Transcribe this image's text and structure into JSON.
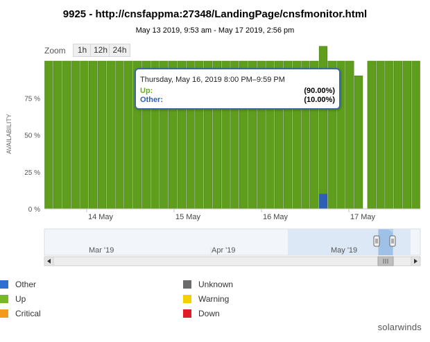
{
  "title": "9925 - http://cnsfappma:27348/LandingPage/cnsfmonitor.html",
  "subtitle": "May 13 2019, 9:53 am - May 17 2019, 2:56 pm",
  "zoom": {
    "label": "Zoom",
    "buttons": [
      "1h",
      "12h",
      "24h"
    ]
  },
  "chart_data": {
    "type": "bar",
    "stacked": true,
    "ylabel": "AVAILABILITY",
    "y_ticks": [
      "0 %",
      "25 %",
      "50 %",
      "75 %"
    ],
    "ylim": [
      0,
      100
    ],
    "x_ticks": [
      "14 May",
      "15 May",
      "16 May",
      "17 May"
    ],
    "bar_count": 42,
    "gap_after_bar": 35,
    "series": [
      {
        "name": "Up",
        "color": "#5e9e1c",
        "values": [
          100,
          100,
          100,
          100,
          100,
          100,
          100,
          100,
          100,
          100,
          100,
          100,
          100,
          100,
          100,
          100,
          100,
          100,
          100,
          100,
          100,
          100,
          100,
          100,
          100,
          100,
          100,
          100,
          100,
          100,
          100,
          100,
          100,
          100,
          100,
          90,
          100,
          100,
          100,
          100,
          100,
          100
        ]
      },
      {
        "name": "Other",
        "color": "#2f5fb4",
        "values": [
          0,
          0,
          0,
          0,
          0,
          0,
          0,
          0,
          0,
          0,
          0,
          0,
          0,
          0,
          0,
          0,
          0,
          0,
          0,
          0,
          0,
          0,
          0,
          0,
          0,
          0,
          0,
          0,
          0,
          0,
          0,
          10,
          0,
          0,
          0,
          0,
          0,
          0,
          0,
          0,
          0,
          0
        ]
      }
    ],
    "grid": false
  },
  "navigator": {
    "labels": [
      "Mar '19",
      "Apr '19",
      "May '19"
    ]
  },
  "tooltip": {
    "title": "Thursday, May 16, 2019 8:00 PM–9:59 PM",
    "up_label": "Up:",
    "up_value": "(90.00%)",
    "other_label": "Other:",
    "other_value": "(10.00%)",
    "up_color": "#6aab1f",
    "other_color": "#2f5fb4"
  },
  "legend": [
    {
      "label": "Other",
      "color": "#2f6fd0"
    },
    {
      "label": "Unknown",
      "color": "#6b6b6b"
    },
    {
      "label": "Up",
      "color": "#76b82a"
    },
    {
      "label": "Warning",
      "color": "#f5d000"
    },
    {
      "label": "Critical",
      "color": "#f39a1c"
    },
    {
      "label": "Down",
      "color": "#e01c24"
    }
  ],
  "logo": {
    "text": "solarwinds",
    "color": "#f07d1a"
  }
}
